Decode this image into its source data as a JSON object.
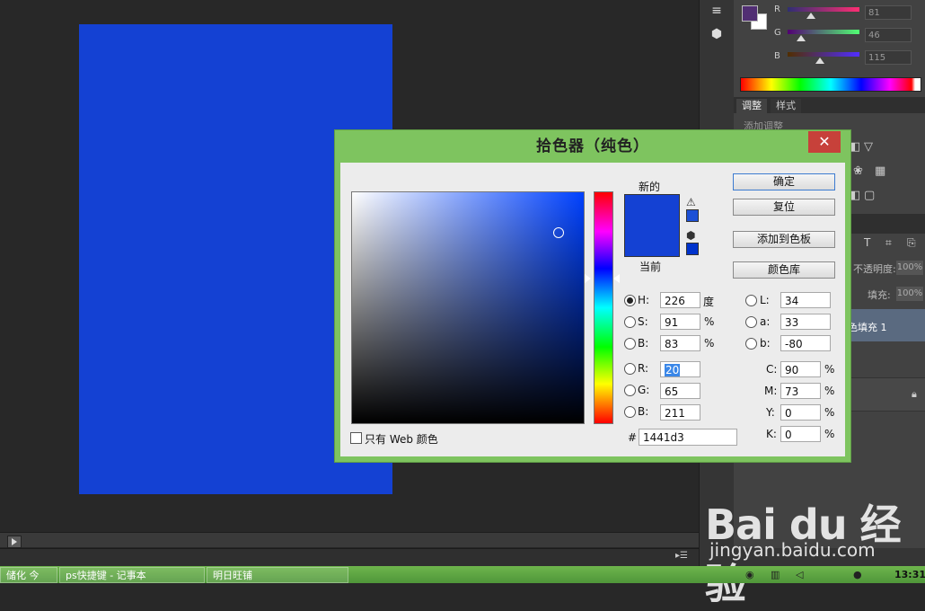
{
  "dialog": {
    "title": "拾色器（纯色）",
    "close": "✕",
    "label_new": "新的",
    "label_current": "当前",
    "buttons": {
      "ok": "确定",
      "reset": "复位",
      "add_to_swatches": "添加到色板",
      "color_libraries": "颜色库"
    },
    "hsb": {
      "h": {
        "label": "H:",
        "value": "226",
        "unit": "度"
      },
      "s": {
        "label": "S:",
        "value": "91",
        "unit": "%"
      },
      "b": {
        "label": "B:",
        "value": "83",
        "unit": "%"
      }
    },
    "rgb": {
      "r": {
        "label": "R:",
        "value": "20"
      },
      "g": {
        "label": "G:",
        "value": "65"
      },
      "b": {
        "label": "B:",
        "value": "211"
      }
    },
    "lab": {
      "l": {
        "label": "L:",
        "value": "34"
      },
      "a": {
        "label": "a:",
        "value": "33"
      },
      "b": {
        "label": "b:",
        "value": "-80"
      }
    },
    "cmyk": {
      "c": {
        "label": "C:",
        "value": "90",
        "unit": "%"
      },
      "m": {
        "label": "M:",
        "value": "73",
        "unit": "%"
      },
      "y": {
        "label": "Y:",
        "value": "0",
        "unit": "%"
      },
      "k": {
        "label": "K:",
        "value": "0",
        "unit": "%"
      }
    },
    "web_only_label": "只有 Web 颜色",
    "hex_label": "#",
    "hex_value": "1441d3",
    "selected_radio": "h"
  },
  "color_panel": {
    "channels": [
      {
        "label": "R",
        "value": "81"
      },
      {
        "label": "G",
        "value": "46"
      },
      {
        "label": "B",
        "value": "115"
      }
    ],
    "foreground": "#512e73",
    "background": "#ffffff"
  },
  "adjustments_panel": {
    "tabs": [
      "调整",
      "样式"
    ],
    "add_adjustment": "添加调整"
  },
  "layers_panel": {
    "opacity_label": "不透明度:",
    "opacity_value": "100%",
    "fill_label": "填充:",
    "fill_value": "100%",
    "layer_name": "色填充 1"
  },
  "taskbar": {
    "items": [
      "储化 今",
      "ps快捷键 - 记事本",
      "明日旺铺"
    ],
    "clock": "13:31"
  },
  "watermark": {
    "logo": "Bai du 经验",
    "url": "jingyan.baidu.com"
  },
  "colors": {
    "document_fill": "#1441d3",
    "dialog_border": "#7ec45f",
    "close_button": "#c7413a"
  }
}
